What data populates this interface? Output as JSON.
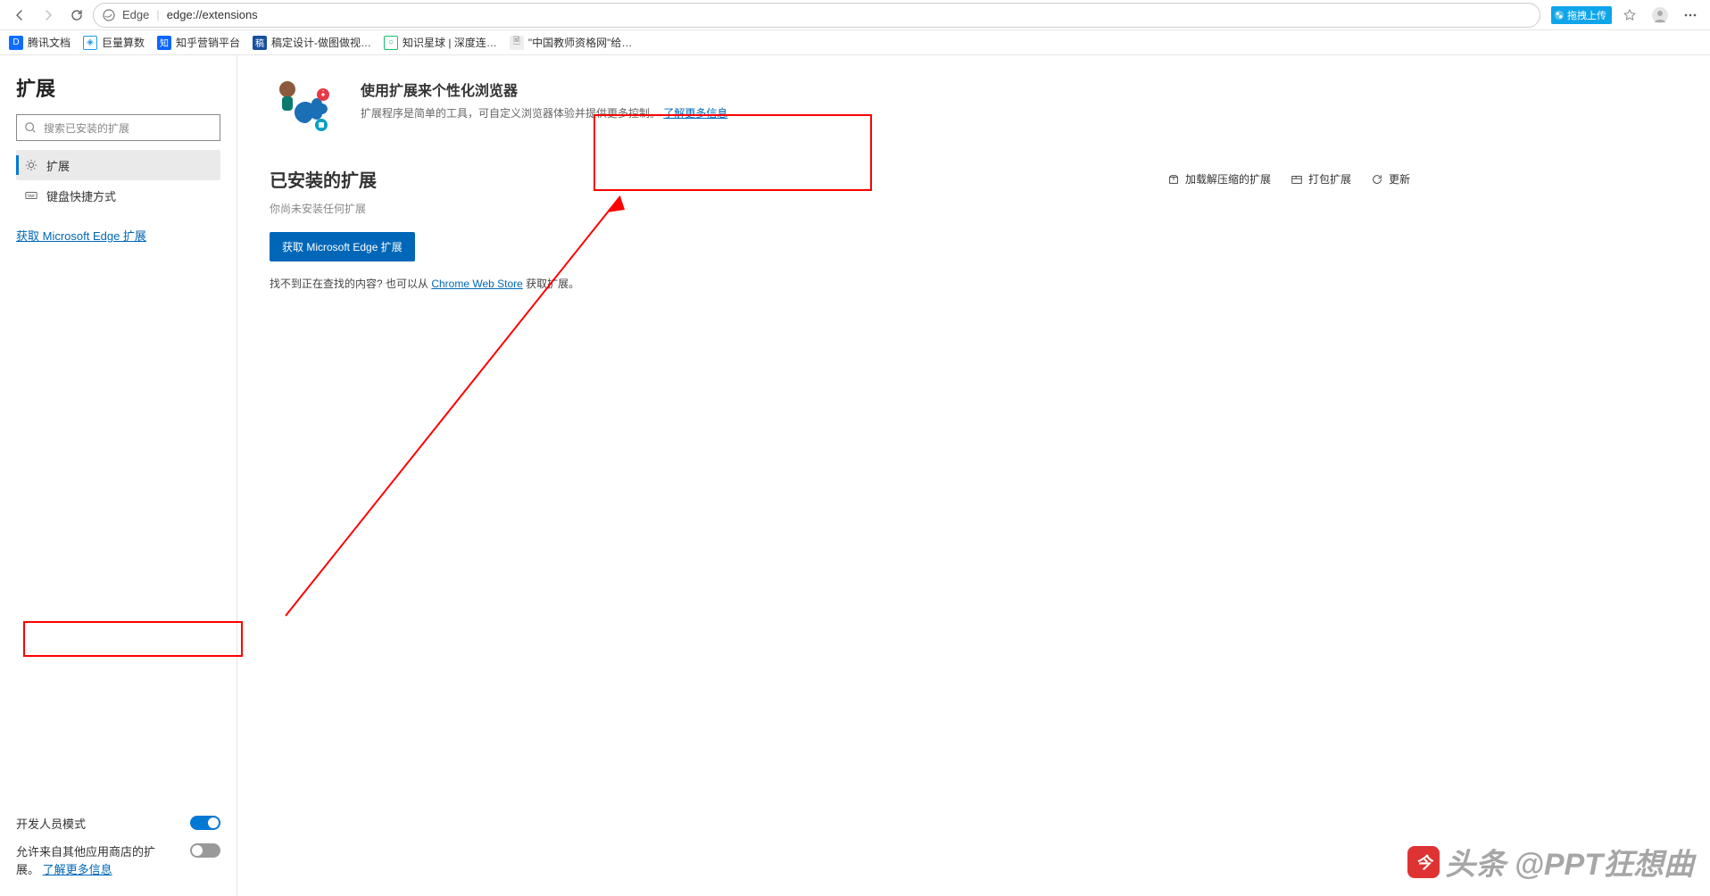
{
  "toolbar": {
    "address_prefix": "Edge",
    "address_url": "edge://extensions",
    "upload_tag": "拖拽上传"
  },
  "bookmarks": [
    {
      "label": "腾讯文档",
      "color": "#0f6cff"
    },
    {
      "label": "巨量算数",
      "color": "#1e9bf0"
    },
    {
      "label": "知乎营销平台",
      "color": "#0a66ff"
    },
    {
      "label": "稿定设计-做图做视…",
      "color": "#1a4fa0"
    },
    {
      "label": "知识星球 | 深度连…",
      "color": "#16c06a"
    },
    {
      "label": "\"中国教师资格网\"给…",
      "color": "#888"
    }
  ],
  "sidebar": {
    "title": "扩展",
    "search_placeholder": "搜索已安装的扩展",
    "items": [
      {
        "label": "扩展"
      },
      {
        "label": "键盘快捷方式"
      }
    ],
    "store_link": "获取 Microsoft Edge 扩展",
    "dev_mode_label": "开发人员模式",
    "other_stores_label": "允许来自其他应用商店的扩展。",
    "learn_more": "了解更多信息"
  },
  "hero": {
    "title": "使用扩展来个性化浏览器",
    "desc": "扩展程序是简单的工具，可自定义浏览器体验并提供更多控制。",
    "learn_more": "了解更多信息"
  },
  "installed": {
    "title": "已安装的扩展",
    "actions": {
      "load_unpacked": "加载解压缩的扩展",
      "pack": "打包扩展",
      "update": "更新"
    },
    "empty": "你尚未安装任何扩展",
    "get_button": "获取 Microsoft Edge 扩展",
    "footnote_prefix": "找不到正在查找的内容? 也可以从 ",
    "footnote_link": "Chrome Web Store",
    "footnote_suffix": " 获取扩展。"
  },
  "watermark": "头条 @PPT狂想曲"
}
